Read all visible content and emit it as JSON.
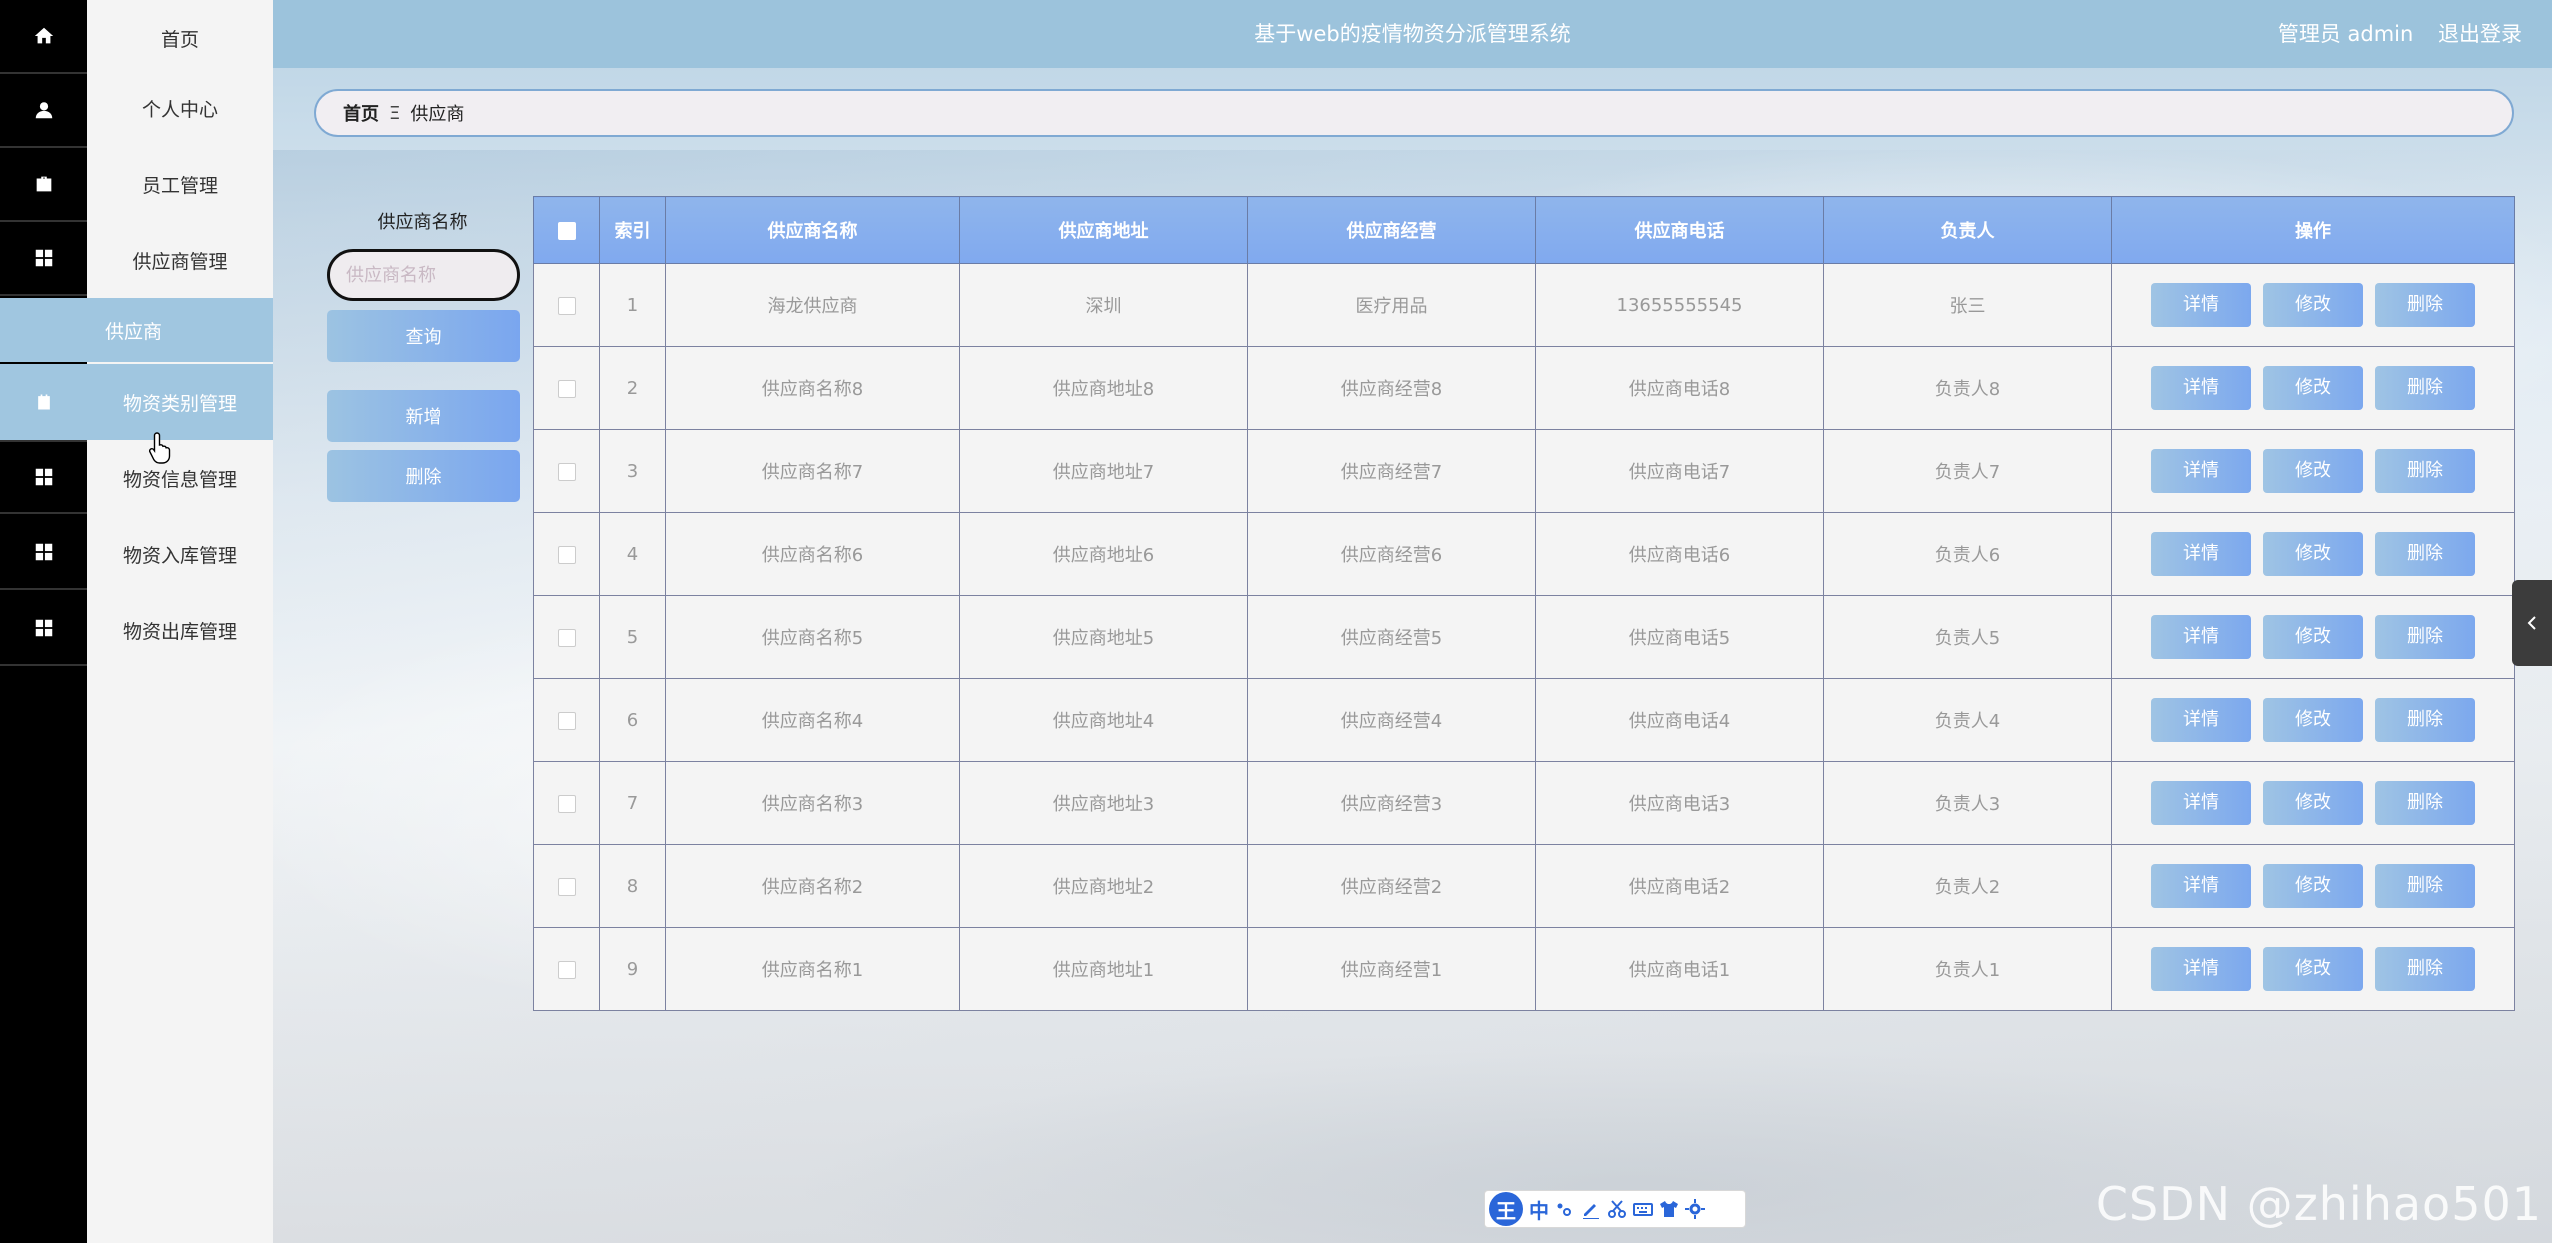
{
  "header": {
    "title": "基于web的疫情物资分派管理系统",
    "user": "管理员 admin",
    "logout": "退出登录"
  },
  "sidebar": {
    "items": [
      {
        "label": "首页",
        "icon": "home-icon"
      },
      {
        "label": "个人中心",
        "icon": "user-icon"
      },
      {
        "label": "员工管理",
        "icon": "briefcase-icon"
      },
      {
        "label": "供应商管理",
        "icon": "grid-icon"
      },
      {
        "label": "物资类别管理",
        "icon": "clipboard-icon"
      },
      {
        "label": "物资信息管理",
        "icon": "grid-icon"
      },
      {
        "label": "物资入库管理",
        "icon": "grid-icon"
      },
      {
        "label": "物资出库管理",
        "icon": "grid-icon"
      }
    ],
    "submenu": {
      "label": "供应商"
    }
  },
  "breadcrumb": {
    "home": "首页",
    "separator": "Ξ",
    "current": "供应商"
  },
  "search": {
    "label": "供应商名称",
    "placeholder": "供应商名称",
    "query_button": "查询",
    "add_button": "新增",
    "delete_button": "删除"
  },
  "table": {
    "headers": [
      "索引",
      "供应商名称",
      "供应商地址",
      "供应商经营",
      "供应商电话",
      "负责人",
      "操作"
    ],
    "actions": {
      "detail": "详情",
      "edit": "修改",
      "delete": "删除"
    },
    "rows": [
      {
        "index": "1",
        "name": "海龙供应商",
        "address": "深圳",
        "business": "医疗用品",
        "phone": "13655555545",
        "manager": "张三"
      },
      {
        "index": "2",
        "name": "供应商名称8",
        "address": "供应商地址8",
        "business": "供应商经营8",
        "phone": "供应商电话8",
        "manager": "负责人8"
      },
      {
        "index": "3",
        "name": "供应商名称7",
        "address": "供应商地址7",
        "business": "供应商经营7",
        "phone": "供应商电话7",
        "manager": "负责人7"
      },
      {
        "index": "4",
        "name": "供应商名称6",
        "address": "供应商地址6",
        "business": "供应商经营6",
        "phone": "供应商电话6",
        "manager": "负责人6"
      },
      {
        "index": "5",
        "name": "供应商名称5",
        "address": "供应商地址5",
        "business": "供应商经营5",
        "phone": "供应商电话5",
        "manager": "负责人5"
      },
      {
        "index": "6",
        "name": "供应商名称4",
        "address": "供应商地址4",
        "business": "供应商经营4",
        "phone": "供应商电话4",
        "manager": "负责人4"
      },
      {
        "index": "7",
        "name": "供应商名称3",
        "address": "供应商地址3",
        "business": "供应商经营3",
        "phone": "供应商电话3",
        "manager": "负责人3"
      },
      {
        "index": "8",
        "name": "供应商名称2",
        "address": "供应商地址2",
        "business": "供应商经营2",
        "phone": "供应商电话2",
        "manager": "负责人2"
      },
      {
        "index": "9",
        "name": "供应商名称1",
        "address": "供应商地址1",
        "business": "供应商经营1",
        "phone": "供应商电话1",
        "manager": "负责人1"
      }
    ]
  },
  "ime": {
    "logo": "王",
    "mode": "中"
  },
  "watermark": "CSDN @zhihao501",
  "colors": {
    "header": "#9cc3dc",
    "accent": "#7aa6ef",
    "sidebar_active": "#a0c6e0"
  }
}
